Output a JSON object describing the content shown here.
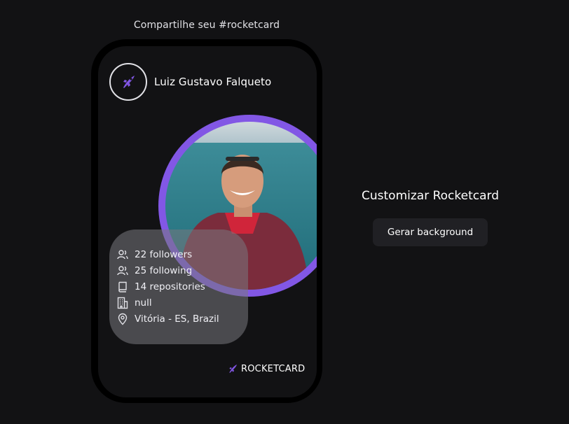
{
  "header": {
    "share_caption": "Compartilhe seu #rocketcard"
  },
  "card": {
    "user_name": "Luiz Gustavo Falqueto",
    "stats": [
      {
        "icon": "followers-icon",
        "label": "22 followers"
      },
      {
        "icon": "following-icon",
        "label": "25 following"
      },
      {
        "icon": "repository-icon",
        "label": "14 repositories"
      },
      {
        "icon": "company-icon",
        "label": "null"
      },
      {
        "icon": "location-icon",
        "label": "Vitória - ES, Brazil"
      }
    ],
    "brand_label": "ROCKETCARD"
  },
  "customize": {
    "title": "Customizar Rocketcard",
    "button_label": "Gerar background"
  },
  "colors": {
    "background": "#121214",
    "accent": "#8257e5",
    "card_frame": "#000000",
    "button": "#202024"
  }
}
